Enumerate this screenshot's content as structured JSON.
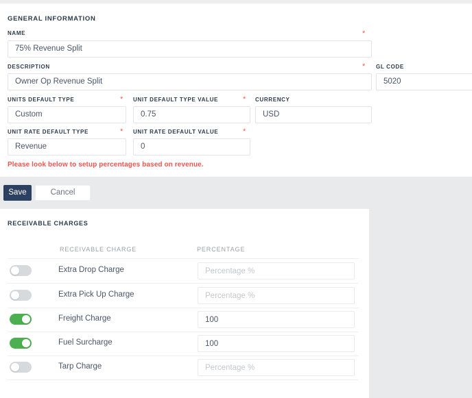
{
  "general": {
    "section_title": "GENERAL INFORMATION",
    "fields": {
      "name": {
        "label": "NAME",
        "value": "75% Revenue Split",
        "required": "*"
      },
      "description": {
        "label": "DESCRIPTION",
        "value": "Owner Op Revenue Split",
        "required": "*"
      },
      "gl_code": {
        "label": "GL CODE",
        "value": "5020"
      },
      "units_default_type": {
        "label": "UNITS DEFAULT TYPE",
        "value": "Custom",
        "required": "*"
      },
      "unit_default_type_value": {
        "label": "UNIT DEFAULT TYPE VALUE",
        "value": "0.75",
        "required": "*"
      },
      "currency": {
        "label": "CURRENCY",
        "value": "USD"
      },
      "unit_rate_default_type": {
        "label": "UNIT RATE DEFAULT TYPE",
        "value": "Revenue",
        "required": "*"
      },
      "unit_rate_default_value": {
        "label": "UNIT RATE DEFAULT VALUE",
        "value": "0",
        "required": "*"
      }
    },
    "error_note": "Please look below to setup percentages based on revenue."
  },
  "actions": {
    "save_label": "Save",
    "cancel_label": "Cancel"
  },
  "receivable_charges": {
    "section_title": "RECEIVABLE CHARGES",
    "columns": [
      "RECEIVABLE CHARGE",
      "PERCENTAGE"
    ],
    "percentage_placeholder": "Percentage %",
    "rows": [
      {
        "name": "Extra Drop Charge",
        "enabled": false,
        "percentage": ""
      },
      {
        "name": "Extra Pick Up Charge",
        "enabled": false,
        "percentage": ""
      },
      {
        "name": "Freight Charge",
        "enabled": true,
        "percentage": "100"
      },
      {
        "name": "Fuel Surcharge",
        "enabled": true,
        "percentage": "100"
      },
      {
        "name": "Tarp Charge",
        "enabled": false,
        "percentage": ""
      }
    ]
  },
  "colors": {
    "accent_dark": "#2c4162",
    "toggle_on": "#4caf50",
    "error_red": "#ef5350",
    "required_star": "#f05a5a",
    "page_gray": "#e9eaec"
  }
}
